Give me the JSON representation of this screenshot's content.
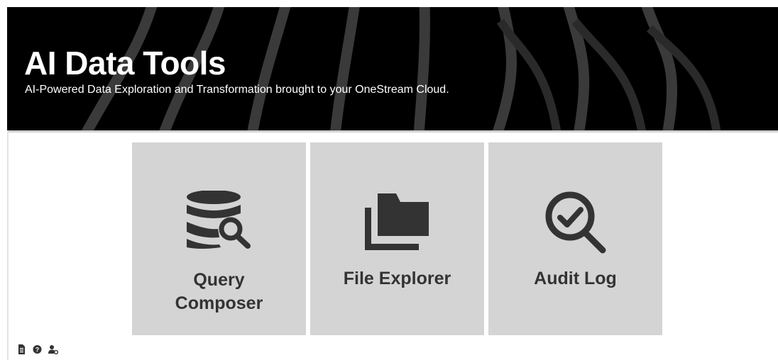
{
  "header": {
    "title": "AI Data Tools",
    "subtitle": "AI-Powered Data Exploration and Transformation brought to your OneStream Cloud."
  },
  "tiles": [
    {
      "label": "Query\nComposer",
      "icon": "database-search-icon"
    },
    {
      "label": "File Explorer",
      "icon": "folder-stack-icon"
    },
    {
      "label": "Audit Log",
      "icon": "magnifier-check-icon"
    }
  ],
  "footer": {
    "icons": [
      "document-icon",
      "help-icon",
      "user-settings-icon"
    ]
  },
  "colors": {
    "banner_bg": "#000000",
    "tile_bg": "#d4d4d4",
    "tile_text": "#333333",
    "icon": "#333333"
  }
}
